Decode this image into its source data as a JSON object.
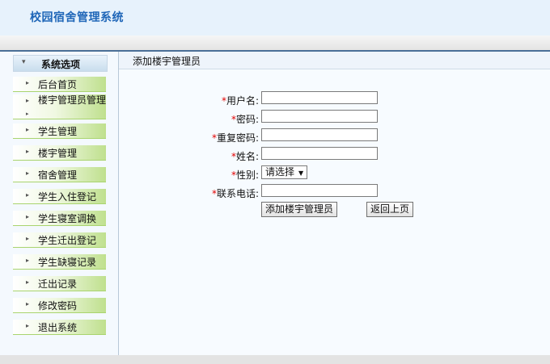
{
  "app": {
    "title": "校园宿舍管理系统"
  },
  "sidebar": {
    "header": "系统选项",
    "items": [
      {
        "label": "后台首页"
      },
      {
        "label": "楼宇管理员管理"
      },
      {
        "label": "学生管理"
      },
      {
        "label": "楼宇管理"
      },
      {
        "label": "宿舍管理"
      },
      {
        "label": "学生入住登记"
      },
      {
        "label": "学生寝室调换"
      },
      {
        "label": "学生迁出登记"
      },
      {
        "label": "学生缺寝记录"
      },
      {
        "label": "迁出记录"
      },
      {
        "label": "修改密码"
      },
      {
        "label": "退出系统"
      }
    ]
  },
  "main": {
    "title": "添加楼宇管理员",
    "form": {
      "required_mark": "*",
      "username_label": "用户名:",
      "username_value": "",
      "password_label": "密码:",
      "password_value": "",
      "repeat_password_label": "重复密码:",
      "repeat_password_value": "",
      "name_label": "姓名:",
      "name_value": "",
      "gender_label": "性别:",
      "gender_selected": "请选择",
      "phone_label": "联系电话:",
      "phone_value": "",
      "submit_label": "添加楼宇管理员",
      "back_label": "返回上页"
    }
  }
}
